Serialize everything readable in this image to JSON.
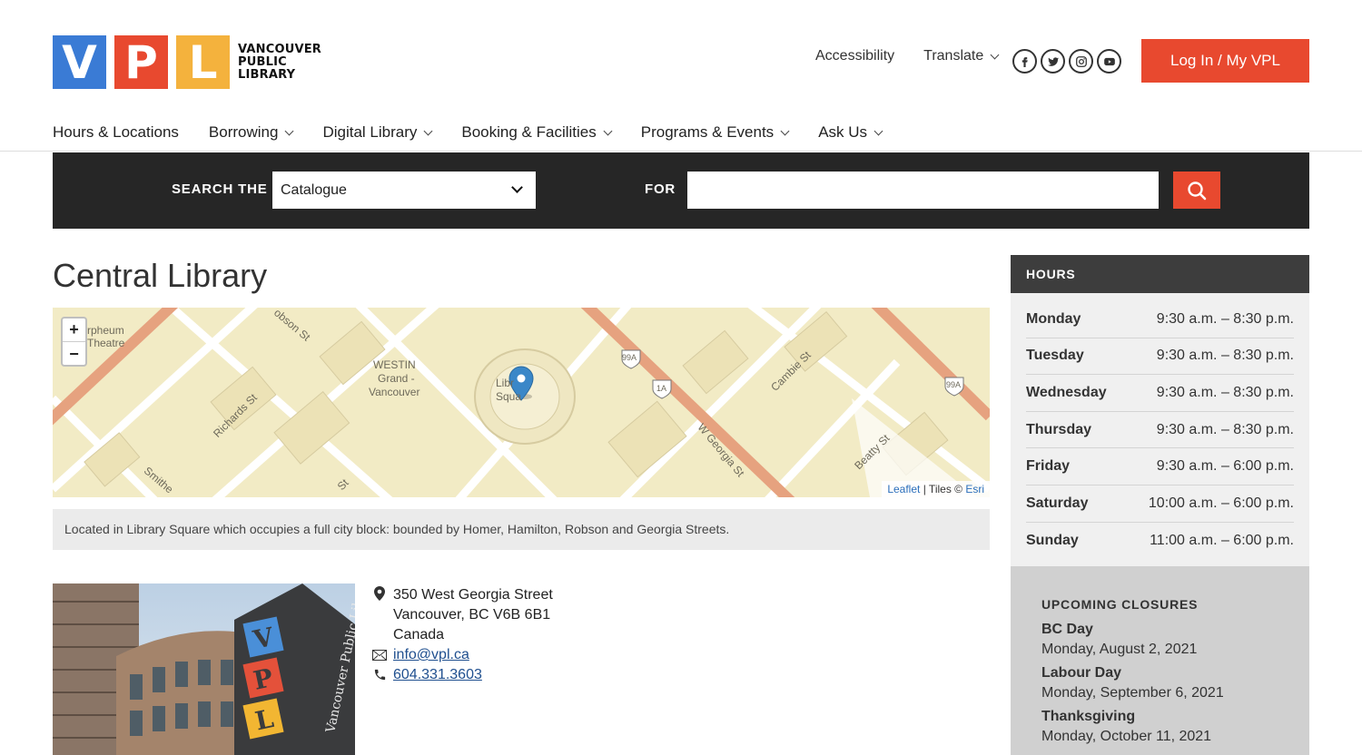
{
  "brand": {
    "tiles": [
      "V",
      "P",
      "L"
    ],
    "name_lines": [
      "VANCOUVER",
      "PUBLIC",
      "LIBRARY"
    ],
    "colors": {
      "blue": "#3a7bd5",
      "red": "#e8492f",
      "yellow": "#f4b23d"
    }
  },
  "utility": {
    "accessibility": "Accessibility",
    "translate": "Translate",
    "social": [
      "facebook-icon",
      "twitter-icon",
      "instagram-icon",
      "youtube-icon"
    ],
    "login": "Log In / My VPL"
  },
  "nav": {
    "items": [
      {
        "label": "Hours & Locations",
        "dropdown": false
      },
      {
        "label": "Borrowing",
        "dropdown": true
      },
      {
        "label": "Digital Library",
        "dropdown": true
      },
      {
        "label": "Booking & Facilities",
        "dropdown": true
      },
      {
        "label": "Programs & Events",
        "dropdown": true
      },
      {
        "label": "Ask Us",
        "dropdown": true
      }
    ]
  },
  "search": {
    "label_the": "SEARCH THE",
    "scope": "Catalogue",
    "label_for": "FOR",
    "query": ""
  },
  "page": {
    "title": "Central Library"
  },
  "map": {
    "labels": {
      "orpheum": "rpheum",
      "theatre": "Theatre",
      "westin1": "WESTIN",
      "westin2": "Grand -",
      "westin3": "Vancouver",
      "lib1": "Libr",
      "lib2": "Squa",
      "richards": "Richards St",
      "smithe": "Smithe",
      "robson": "obson St",
      "georgia": "W Georgia St",
      "cambie": "Cambie St",
      "beatty": "Beatty St",
      "hwy99a": "99A",
      "hwy1a": "1A",
      "hwy99a2": "99A",
      "st": "St"
    },
    "zoom_in": "+",
    "zoom_out": "−",
    "attribution": {
      "leaflet": "Leaflet",
      "sep": " | Tiles © ",
      "esri": "Esri"
    }
  },
  "caption": "Located in Library Square which occupies a full city block: bounded by Homer, Hamilton, Robson and Georgia Streets.",
  "contact": {
    "address": [
      "350 West Georgia Street",
      "Vancouver, BC V6B 6B1",
      "Canada"
    ],
    "email": "info@vpl.ca",
    "phone": "604.331.3603"
  },
  "hours": {
    "heading": "HOURS",
    "rows": [
      {
        "day": "Monday",
        "time": "9:30 a.m. – 8:30 p.m."
      },
      {
        "day": "Tuesday",
        "time": "9:30 a.m. – 8:30 p.m."
      },
      {
        "day": "Wednesday",
        "time": "9:30 a.m. – 8:30 p.m."
      },
      {
        "day": "Thursday",
        "time": "9:30 a.m. – 8:30 p.m."
      },
      {
        "day": "Friday",
        "time": "9:30 a.m. – 6:00 p.m."
      },
      {
        "day": "Saturday",
        "time": "10:00 a.m. – 6:00 p.m."
      },
      {
        "day": "Sunday",
        "time": "11:00 a.m. – 6:00 p.m."
      }
    ]
  },
  "closures": {
    "heading": "UPCOMING CLOSURES",
    "items": [
      {
        "name": "BC Day",
        "date": "Monday, August 2, 2021"
      },
      {
        "name": "Labour Day",
        "date": "Monday, September 6, 2021"
      },
      {
        "name": "Thanksgiving",
        "date": "Monday, October 11, 2021"
      }
    ]
  },
  "photo_sign": {
    "letters": [
      "V",
      "P",
      "L"
    ],
    "text": "Vancouver Public Library"
  }
}
